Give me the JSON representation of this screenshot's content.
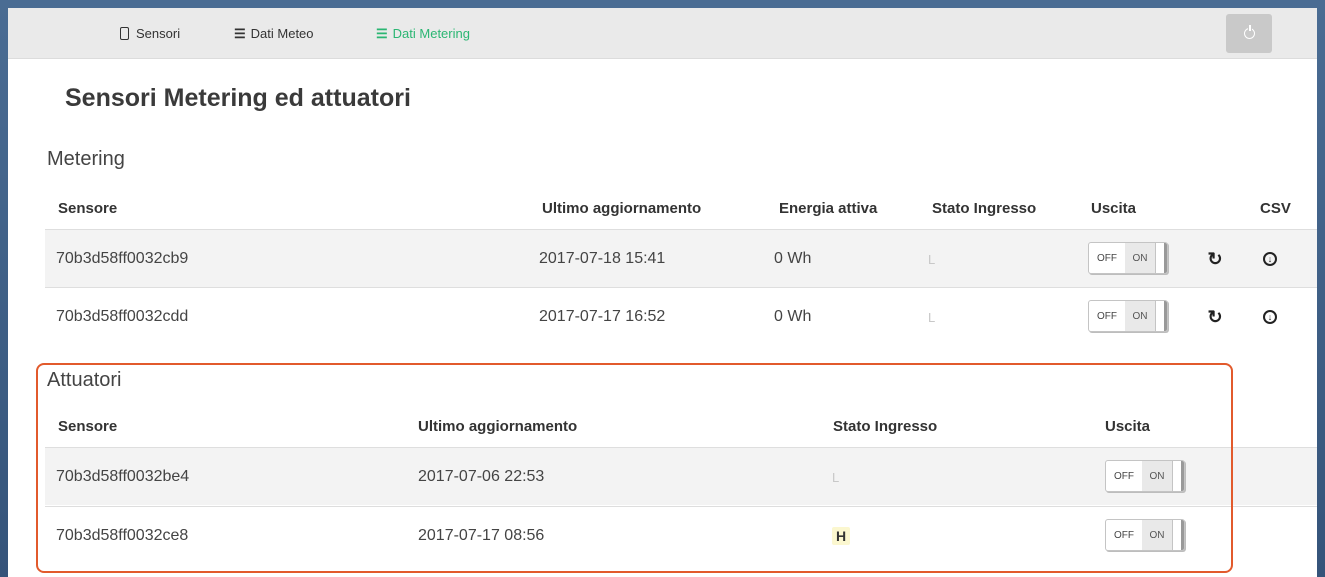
{
  "nav": {
    "items": [
      {
        "label": "Sensori",
        "icon": "mobile-icon"
      },
      {
        "label": "Dati Meteo",
        "icon": "list-icon"
      },
      {
        "label": "Dati Metering",
        "icon": "list-icon",
        "active": true
      }
    ],
    "power_icon": "power-icon"
  },
  "page_title": "Sensori Metering ed attuatori",
  "metering": {
    "title": "Metering",
    "headers": {
      "sensore": "Sensore",
      "ultimo": "Ultimo aggiornamento",
      "energia": "Energia attiva",
      "stato": "Stato Ingresso",
      "uscita": "Uscita",
      "csv": "CSV"
    },
    "rows": [
      {
        "sensore": "70b3d58ff0032cb9",
        "ultimo": "2017-07-18 15:41",
        "energia": "0 Wh",
        "stato": "L"
      },
      {
        "sensore": "70b3d58ff0032cdd",
        "ultimo": "2017-07-17 16:52",
        "energia": "0 Wh",
        "stato": "L"
      }
    ]
  },
  "attuatori": {
    "title": "Attuatori",
    "headers": {
      "sensore": "Sensore",
      "ultimo": "Ultimo aggiornamento",
      "stato": "Stato Ingresso",
      "uscita": "Uscita"
    },
    "rows": [
      {
        "sensore": "70b3d58ff0032be4",
        "ultimo": "2017-07-06 22:53",
        "stato": "L"
      },
      {
        "sensore": "70b3d58ff0032ce8",
        "ultimo": "2017-07-17 08:56",
        "stato": "H"
      }
    ]
  },
  "toggle": {
    "off_label": "OFF",
    "on_label": "ON"
  },
  "colors": {
    "active_nav": "#2bb673",
    "highlight_border": "#e25a2c",
    "state_h_bg": "#fbf7cf"
  }
}
